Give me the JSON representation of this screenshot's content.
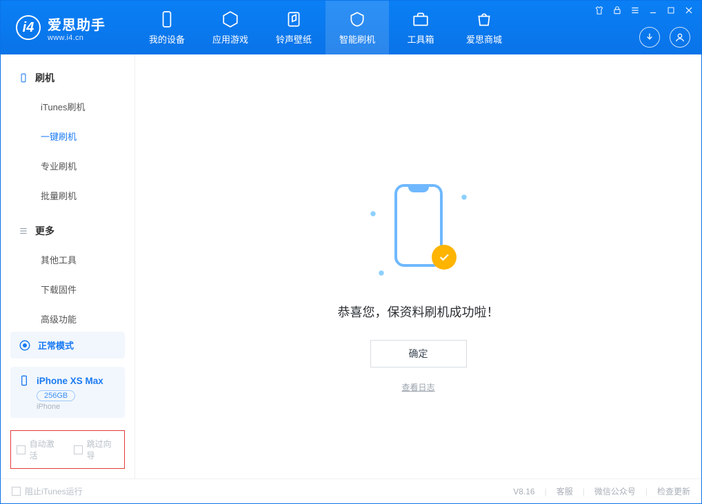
{
  "app": {
    "name": "爱思助手",
    "url": "www.i4.cn"
  },
  "nav": {
    "tabs": [
      {
        "label": "我的设备"
      },
      {
        "label": "应用游戏"
      },
      {
        "label": "铃声壁纸"
      },
      {
        "label": "智能刷机"
      },
      {
        "label": "工具箱"
      },
      {
        "label": "爱思商城"
      }
    ]
  },
  "sidebar": {
    "groups": [
      {
        "title": "刷机",
        "items": [
          "iTunes刷机",
          "一键刷机",
          "专业刷机",
          "批量刷机"
        ],
        "active_index": 1
      },
      {
        "title": "更多",
        "items": [
          "其他工具",
          "下载固件",
          "高级功能"
        ],
        "active_index": -1
      }
    ],
    "mode_label": "正常模式",
    "device": {
      "name": "iPhone XS Max",
      "capacity": "256GB",
      "type": "iPhone"
    },
    "options": {
      "auto_activate": "自动激活",
      "skip_guide": "跳过向导"
    }
  },
  "main": {
    "success_msg": "恭喜您，保资料刷机成功啦！",
    "ok": "确定",
    "view_log": "查看日志"
  },
  "footer": {
    "block_itunes": "阻止iTunes运行",
    "version": "V8.16",
    "links": [
      "客服",
      "微信公众号",
      "检查更新"
    ]
  }
}
